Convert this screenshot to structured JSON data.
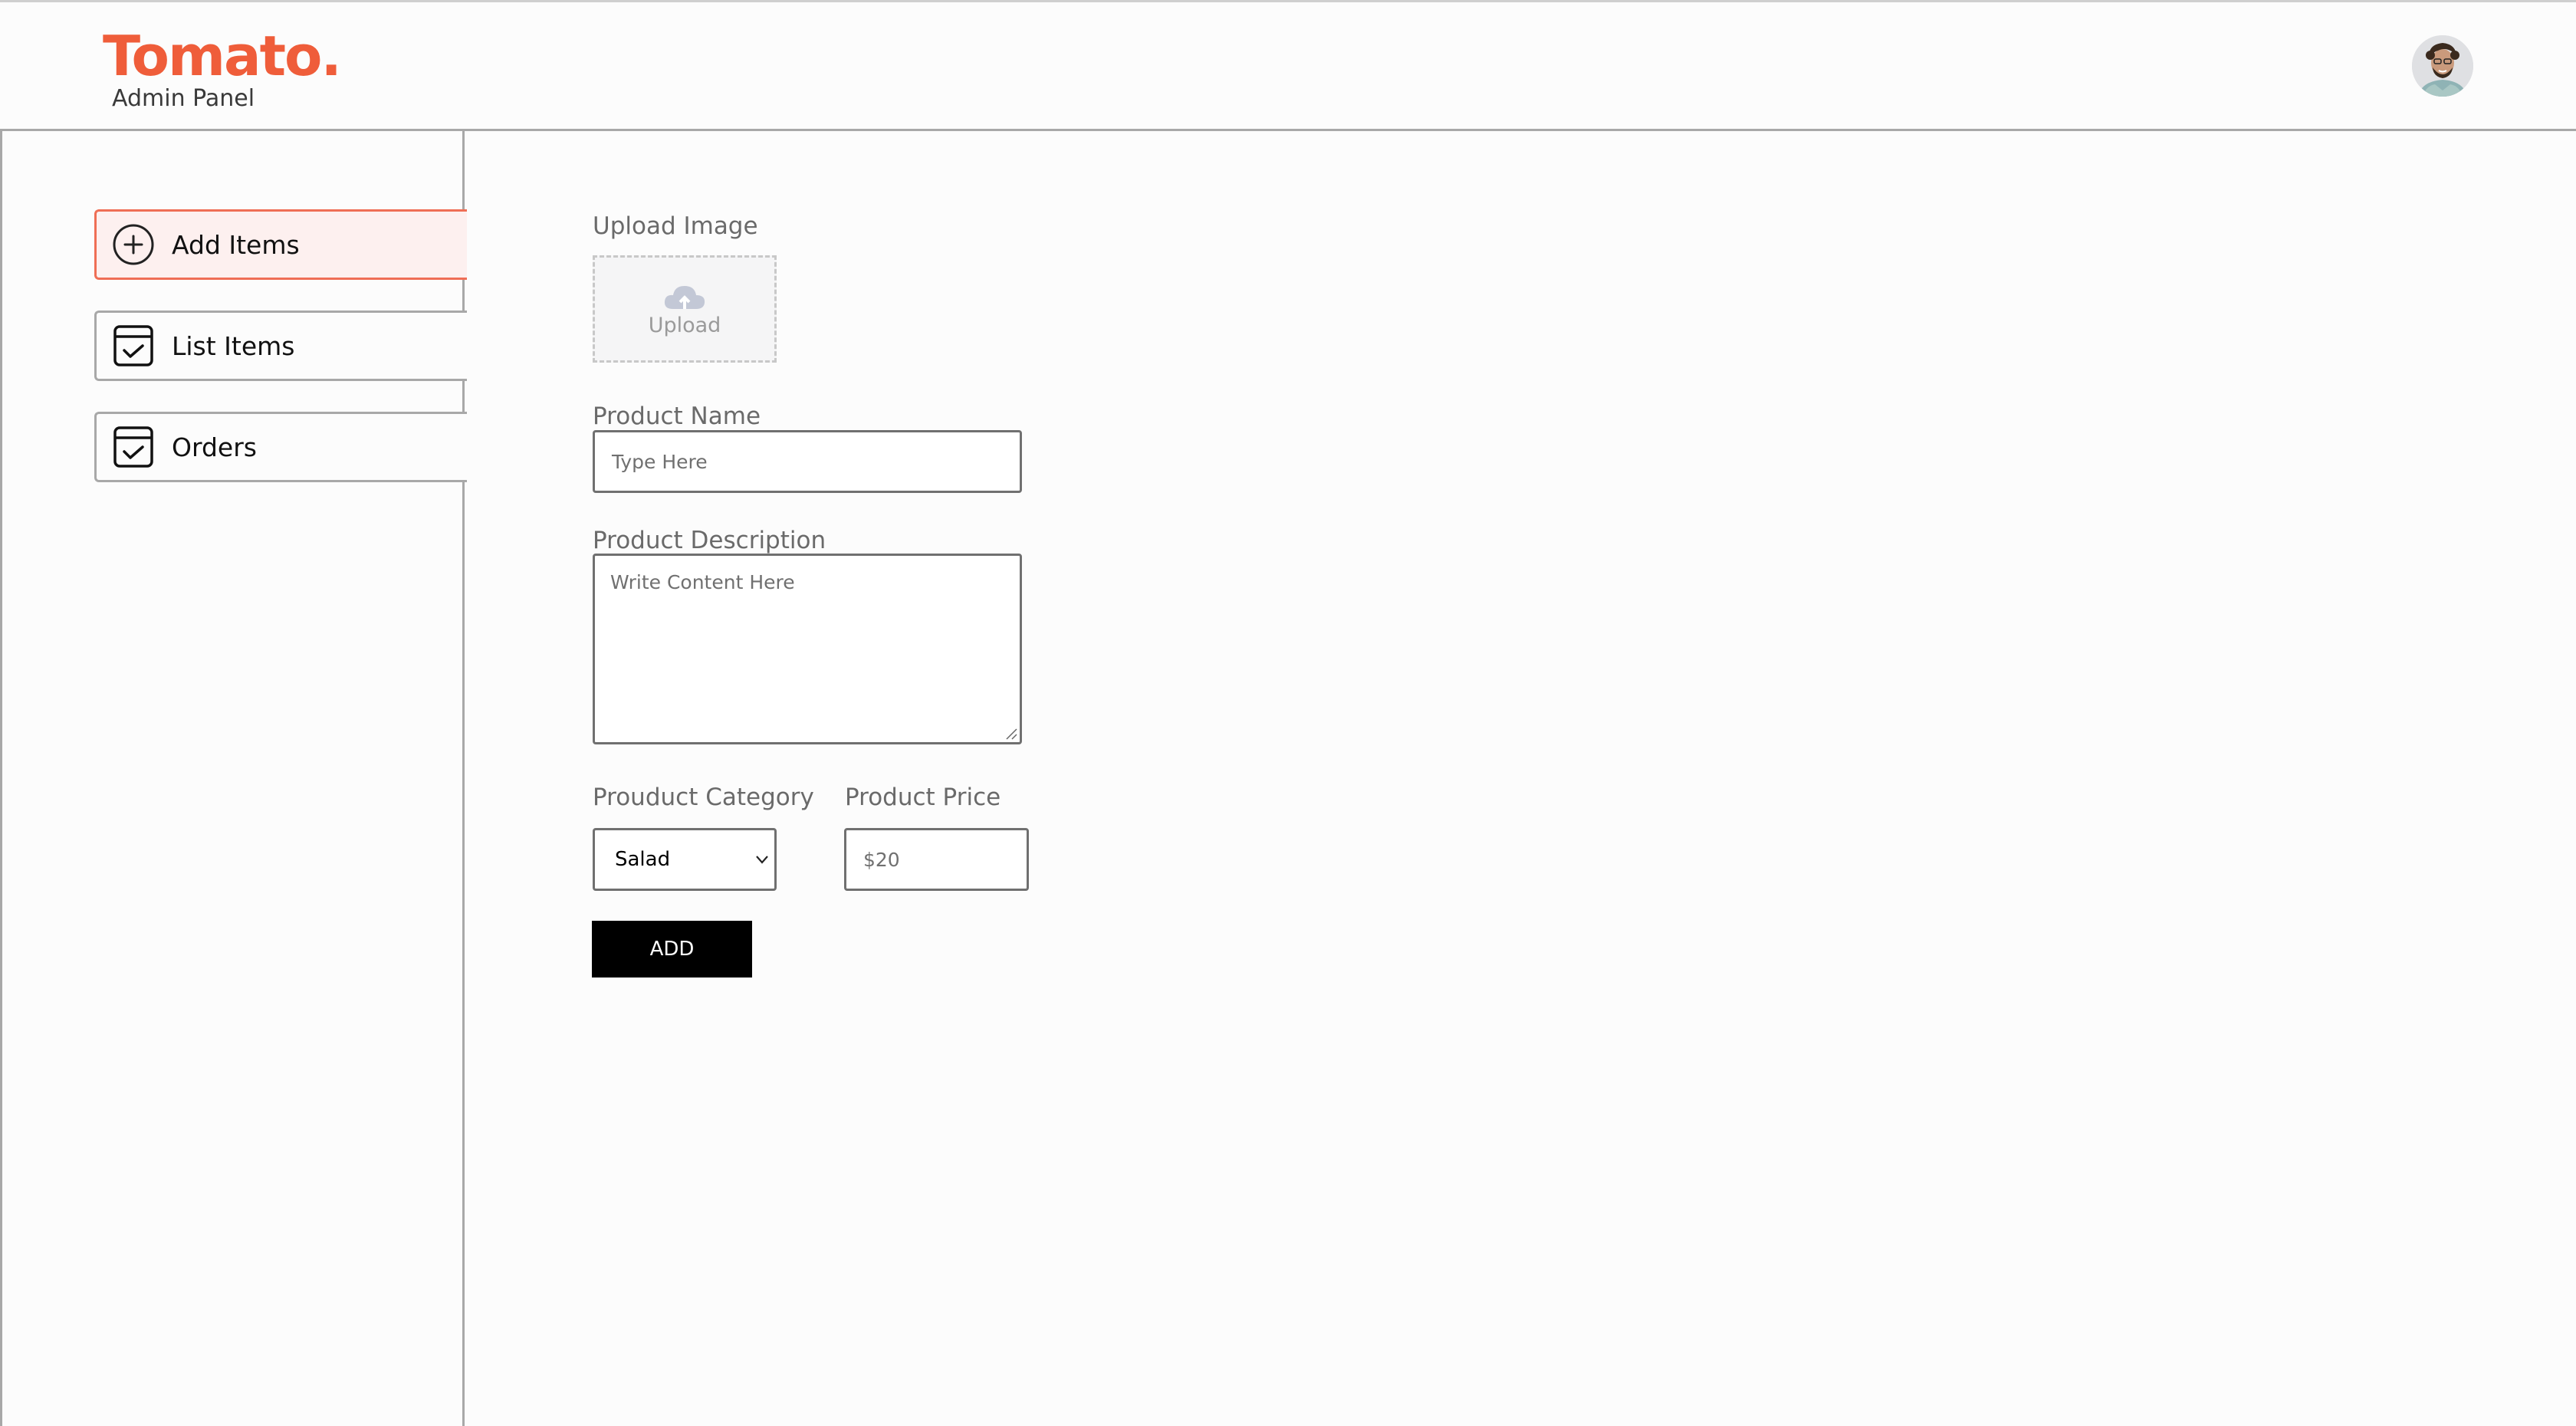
{
  "header": {
    "logo_text": "Tomato.",
    "subtitle": "Admin Panel",
    "avatar_icon": "profile-avatar",
    "brand_color": "#ef5d3a"
  },
  "sidebar": {
    "items": [
      {
        "label": "Add Items",
        "icon": "add-circle-icon",
        "active": true
      },
      {
        "label": "List Items",
        "icon": "calendar-check-icon",
        "active": false
      },
      {
        "label": "Orders",
        "icon": "calendar-check-icon",
        "active": false
      }
    ],
    "active_color": "#ef6e55"
  },
  "form": {
    "upload_label": "Upload Image",
    "upload_button_text": "Upload",
    "upload_icon": "cloud-upload-icon",
    "name_label": "Product Name",
    "name_placeholder": "Type Here",
    "description_label": "Product Description",
    "description_placeholder": "Write Content Here",
    "category_label": "Prouduct Category",
    "category_selected": "Salad",
    "price_label": "Product Price",
    "price_placeholder": "$20",
    "submit_label": "ADD"
  }
}
